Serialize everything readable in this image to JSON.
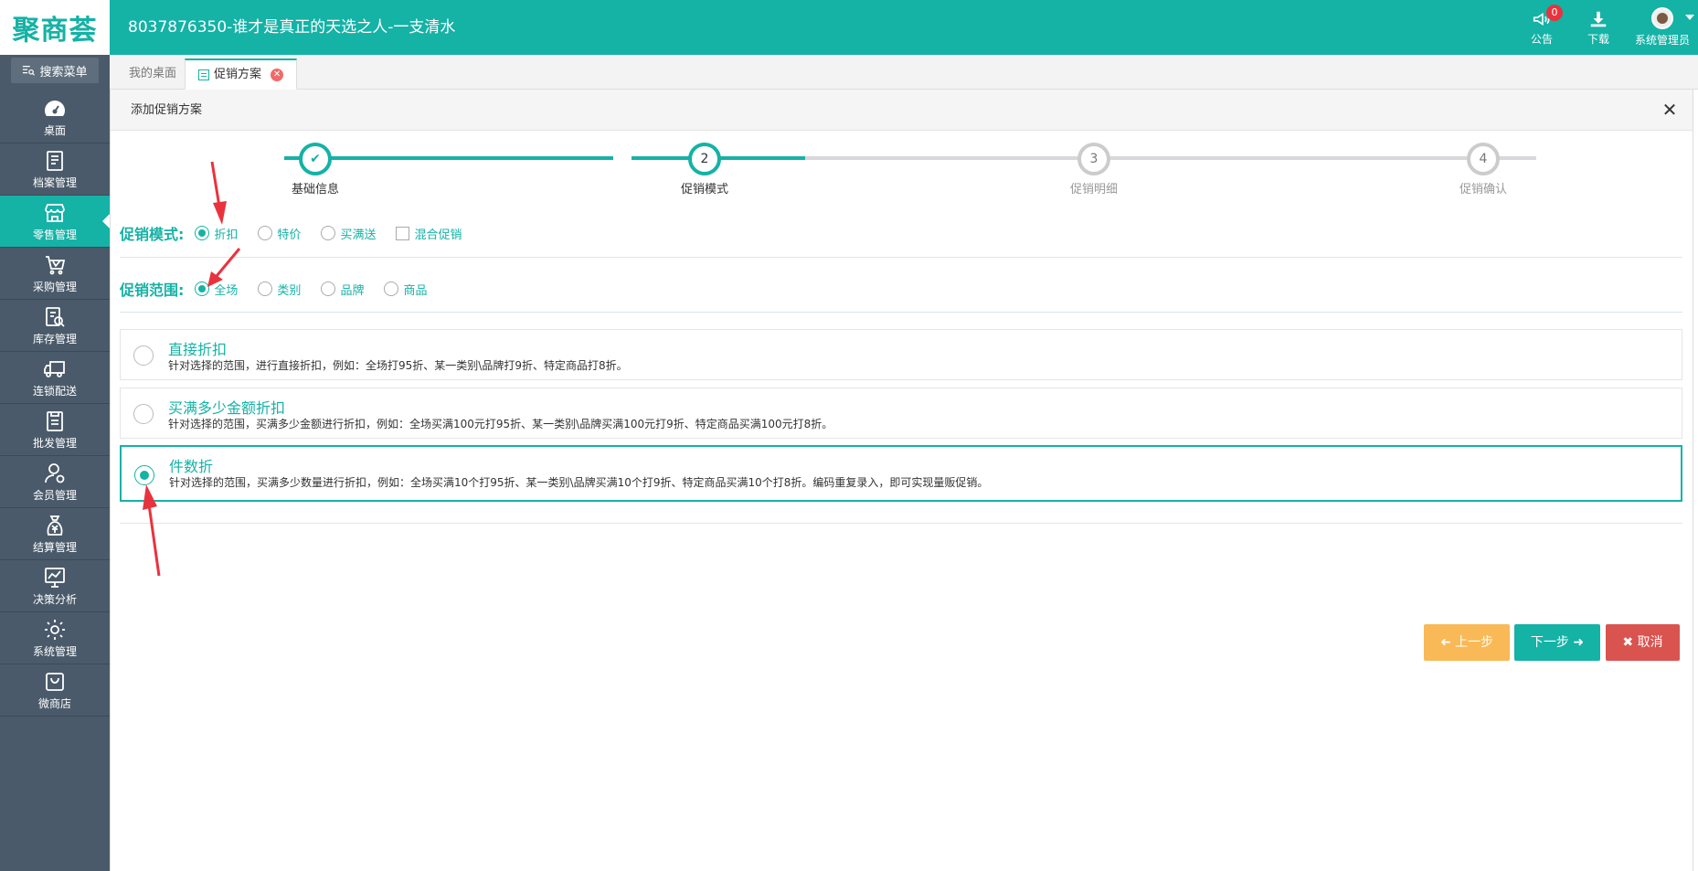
{
  "app": {
    "logo_text": "聚商荟",
    "title": "8037876350-谁才是真正的天选之人-一支清水",
    "brand_color": "#15b2a6"
  },
  "top_actions": {
    "notice": {
      "label": "公告",
      "icon": "megaphone-icon",
      "badge": "0"
    },
    "download": {
      "label": "下载",
      "icon": "download-icon"
    },
    "user": {
      "label": "系统管理员",
      "icon": "avatar"
    }
  },
  "sidebar": {
    "search_label": "搜索菜单",
    "items": [
      {
        "label": "桌面",
        "icon": "dashboard-icon",
        "active": false
      },
      {
        "label": "档案管理",
        "icon": "archive-icon",
        "active": false
      },
      {
        "label": "零售管理",
        "icon": "store-icon",
        "active": true
      },
      {
        "label": "采购管理",
        "icon": "cart-icon",
        "active": false
      },
      {
        "label": "库存管理",
        "icon": "inventory-icon",
        "active": false
      },
      {
        "label": "连锁配送",
        "icon": "truck-icon",
        "active": false
      },
      {
        "label": "批发管理",
        "icon": "wholesale-icon",
        "active": false
      },
      {
        "label": "会员管理",
        "icon": "member-icon",
        "active": false
      },
      {
        "label": "结算管理",
        "icon": "settlement-icon",
        "active": false
      },
      {
        "label": "决策分析",
        "icon": "analysis-icon",
        "active": false
      },
      {
        "label": "系统管理",
        "icon": "gear-icon",
        "active": false
      },
      {
        "label": "微商店",
        "icon": "shop-bag-icon",
        "active": false
      }
    ]
  },
  "tabs": [
    {
      "label": "我的桌面",
      "active": false
    },
    {
      "label": "促销方案",
      "active": true
    }
  ],
  "panel": {
    "title": "添加促销方案",
    "close_symbol": "✕"
  },
  "stepper": {
    "steps": [
      {
        "number": "✔",
        "label": "基础信息",
        "state": "done"
      },
      {
        "number": "2",
        "label": "促销模式",
        "state": "current"
      },
      {
        "number": "3",
        "label": "促销明细",
        "state": "pending"
      },
      {
        "number": "4",
        "label": "促销确认",
        "state": "pending"
      }
    ]
  },
  "promo_mode": {
    "label": "促销模式:",
    "options": [
      {
        "label": "折扣",
        "type": "radio",
        "checked": true
      },
      {
        "label": "特价",
        "type": "radio",
        "checked": false
      },
      {
        "label": "买满送",
        "type": "radio",
        "checked": false
      },
      {
        "label": "混合促销",
        "type": "checkbox",
        "checked": false
      }
    ]
  },
  "promo_scope": {
    "label": "促销范围:",
    "options": [
      {
        "label": "全场",
        "checked": true
      },
      {
        "label": "类别",
        "checked": false
      },
      {
        "label": "品牌",
        "checked": false
      },
      {
        "label": "商品",
        "checked": false
      }
    ]
  },
  "discount_types": [
    {
      "title": "直接折扣",
      "desc": "针对选择的范围，进行直接折扣，例如：全场打95折、某一类别\\品牌打9折、特定商品打8折。",
      "selected": false
    },
    {
      "title": "买满多少金额折扣",
      "desc": "针对选择的范围，买满多少金额进行折扣，例如：全场买满100元打95折、某一类别\\品牌买满100元打9折、特定商品买满100元打8折。",
      "selected": false
    },
    {
      "title": "件数折",
      "desc": "针对选择的范围，买满多少数量进行折扣，例如：全场买满10个打95折、某一类别\\品牌买满10个打9折、特定商品买满10个打8折。编码重复录入，即可实现量贩促销。",
      "selected": true
    }
  ],
  "buttons": {
    "prev": "上一步",
    "next": "下一步",
    "cancel": "取消"
  },
  "colors": {
    "accent": "#15b2a6",
    "sidebar_bg": "#4a5a6a",
    "prev_btn": "#f9b957",
    "cancel_btn": "#d9534f",
    "arrow": "#e8333e"
  }
}
